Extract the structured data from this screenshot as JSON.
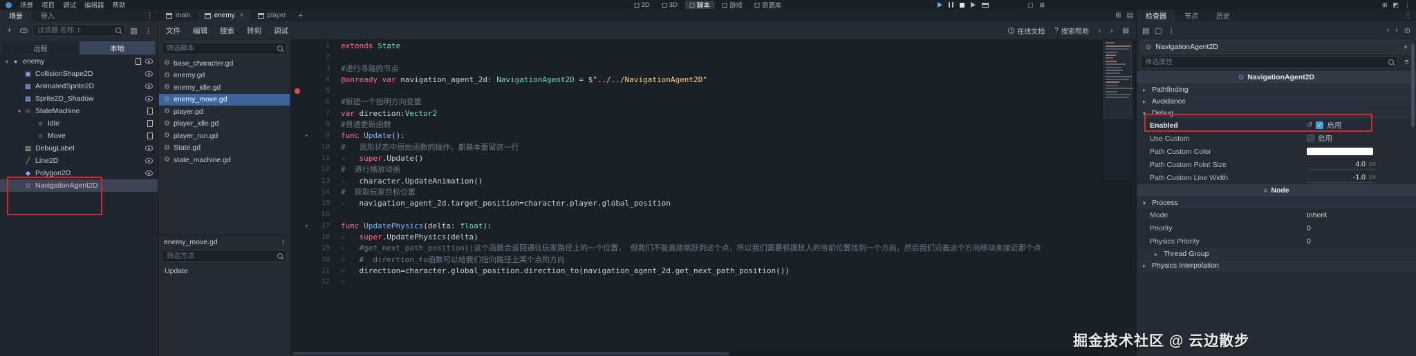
{
  "topbar": {
    "menus": [
      "场景",
      "项目",
      "调试",
      "编辑器",
      "帮助"
    ],
    "modes": [
      {
        "label": "2D"
      },
      {
        "label": "3D"
      },
      {
        "label": "脚本",
        "active": true
      },
      {
        "label": "游戏"
      },
      {
        "label": "资源库"
      }
    ]
  },
  "scene_dock": {
    "tabs": [
      {
        "label": "场景"
      },
      {
        "label": "导入"
      }
    ],
    "filter_placeholder": "过滤器:名称, t",
    "view_tabs": [
      {
        "label": "远程"
      },
      {
        "label": "本地"
      }
    ],
    "tree": [
      {
        "label": "enemy",
        "glyph": "●"
      },
      {
        "label": "CollisionShape2D",
        "glyph": "▣"
      },
      {
        "label": "AnimatedSprite2D",
        "glyph": "▦"
      },
      {
        "label": "Sprite2D_Shadow",
        "glyph": "▦"
      },
      {
        "label": "StateMachine",
        "glyph": "○"
      },
      {
        "label": "Idle",
        "glyph": "○"
      },
      {
        "label": "Move",
        "glyph": "○"
      },
      {
        "label": "DebugLabel",
        "glyph": "▤"
      },
      {
        "label": "Line2D",
        "glyph": "╱"
      },
      {
        "label": "Polygon2D",
        "glyph": "◆"
      },
      {
        "label": "NavigationAgent2D",
        "glyph": "⊙"
      }
    ]
  },
  "scene_tabs": [
    {
      "label": "main"
    },
    {
      "label": "enemy"
    },
    {
      "label": "player"
    }
  ],
  "script_editor": {
    "menus": [
      "文件",
      "编辑",
      "搜索",
      "转到",
      "调试"
    ],
    "online_docs": "在线文档",
    "search_help": "搜索帮助",
    "filter_scripts_placeholder": "筛选脚本",
    "scripts": [
      "base_character.gd",
      "enemy.gd",
      "enemy_idle.gd",
      "enemy_move.gd",
      "player.gd",
      "player_idle.gd",
      "player_run.gd",
      "State.gd",
      "state_machine.gd"
    ],
    "current_script_label": "enemy_move.gd",
    "filter_methods_placeholder": "筛选方法",
    "methods": [
      "Update"
    ]
  },
  "code": {
    "lines": [
      {
        "n": "1",
        "t": [
          "extends ",
          "State"
        ]
      },
      {
        "n": "2",
        "t": []
      },
      {
        "n": "3",
        "t": [
          "#进行寻路的节点"
        ]
      },
      {
        "n": "4",
        "t": [
          "@onready ",
          "var ",
          "navigation_agent_2d: ",
          "NavigationAgent2D",
          " = ",
          "$\"../../NavigationAgent2D\""
        ]
      },
      {
        "n": "5",
        "t": []
      },
      {
        "n": "6",
        "t": [
          "#新建一个指明方向变量"
        ]
      },
      {
        "n": "7",
        "t": [
          "var ",
          "direction:",
          "Vector2"
        ]
      },
      {
        "n": "8",
        "t": [
          "#普通更新函数"
        ]
      },
      {
        "n": "9",
        "t": [
          "func ",
          "Update",
          "():"
        ]
      },
      {
        "n": "10",
        "t": [
          "#   调用状态中原始函数的操作，都基本要留这一行"
        ]
      },
      {
        "n": "11",
        "t": [
          "»   ",
          "super",
          ".Update()"
        ]
      },
      {
        "n": "12",
        "t": [
          "#  进行播放动画"
        ]
      },
      {
        "n": "13",
        "t": [
          "»   ",
          "character.UpdateAnimation()"
        ]
      },
      {
        "n": "14",
        "t": [
          "#  获取玩家目标位置"
        ]
      },
      {
        "n": "15",
        "t": [
          "»   ",
          "navigation_agent_2d.target_position=character.player.global_position"
        ]
      },
      {
        "n": "16",
        "t": []
      },
      {
        "n": "17",
        "t": [
          "func ",
          "UpdatePhysics",
          "(delta: ",
          "float",
          "):"
        ]
      },
      {
        "n": "18",
        "t": [
          "»   ",
          "super",
          ".UpdatePhysics(delta)"
        ]
      },
      {
        "n": "19",
        "t": [
          "»   ",
          "#get_next_path_position()这个函数会返回通往玩家路径上的一个位置， 但我们不能直接跳跃到这个点，所以我们需要根据敌人的当前位置找到一个方向，然后我们沿着这个方向移动来接近那个点"
        ]
      },
      {
        "n": "20",
        "t": [
          "»   ",
          "#  direction_to函数可以给我们指向路径上某个点的方向"
        ]
      },
      {
        "n": "21",
        "t": [
          "»   ",
          "direction=character.global_position.direction_to(navigation_agent_2d.get_next_path_position())"
        ]
      },
      {
        "n": "22",
        "t": [
          "»"
        ]
      }
    ]
  },
  "inspector": {
    "tabs": [
      "检查器",
      "节点",
      "历史"
    ],
    "object_name": "NavigationAgent2D",
    "filter_placeholder": "筛选属性",
    "category_object": "NavigationAgent2D",
    "category_node": "Node",
    "sections": {
      "pathfinding": "Pathfinding",
      "avoidance": "Avoidance",
      "debug": "Debug",
      "process": "Process",
      "thread_group": "Thread Group",
      "physics_interpolation": "Physics Interpolation"
    },
    "props": {
      "enabled": {
        "label": "Enabled",
        "check_label": "启用",
        "checked": true
      },
      "use_custom": {
        "label": "Use Custom",
        "check_label": "启用",
        "checked": false
      },
      "path_custom_color": {
        "label": "Path Custom Color",
        "value": "#ffffff"
      },
      "path_custom_point_size": {
        "label": "Path Custom Point Size",
        "value": "4.0",
        "suffix": "px"
      },
      "path_custom_line_width": {
        "label": "Path Custom Line Width",
        "value": "-1.0",
        "suffix": "px"
      },
      "mode": {
        "label": "Mode",
        "value": "Inherit"
      },
      "priority": {
        "label": "Priority",
        "value": "0"
      },
      "physics_priority": {
        "label": "Physics Priority",
        "value": "0"
      }
    }
  },
  "watermark": "掘金技术社区 @ 云边散步",
  "glyphs": {
    "expand": "▾",
    "collapse": "▸",
    "dots": "⋮",
    "plus": "+",
    "close": "×",
    "back": "‹",
    "forward": "›",
    "question": "?",
    "page": "▤",
    "grid": "⊞",
    "gear": "⚙",
    "revert": "↺",
    "pin": "⊙",
    "node_circle": "○",
    "sort": "↕",
    "check": "✓",
    "filter_options": "▧",
    "square": "▢",
    "half": "◩",
    "list": "≡"
  },
  "colors": {
    "accent": "#4a9bd6",
    "selection_blue": "#3d659a",
    "selection_gray": "#3d4456",
    "annotation_red": "#cb2e2e",
    "color_swatch": "#ffffff",
    "breakpoint_red": "#e04c4c"
  }
}
